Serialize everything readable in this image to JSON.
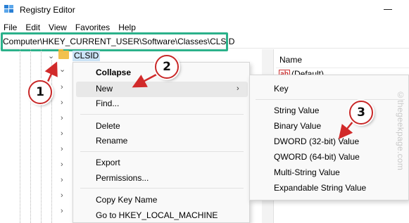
{
  "window": {
    "title": "Registry Editor"
  },
  "menu": {
    "items": [
      "File",
      "Edit",
      "View",
      "Favorites",
      "Help"
    ]
  },
  "address": {
    "path": "Computer\\HKEY_CURRENT_USER\\Software\\Classes\\CLSID"
  },
  "tree": {
    "selected": "CLSID"
  },
  "right_pane": {
    "column_name": "Name",
    "default_value_name": "(Default)",
    "default_icon_text": "ab"
  },
  "context_menu": {
    "collapse": "Collapse",
    "new": "New",
    "find": "Find...",
    "delete": "Delete",
    "rename": "Rename",
    "export": "Export",
    "permissions": "Permissions...",
    "copy_key_name": "Copy Key Name",
    "goto": "Go to HKEY_LOCAL_MACHINE"
  },
  "submenu": {
    "key": "Key",
    "string_value": "String Value",
    "binary_value": "Binary Value",
    "dword_value": "DWORD (32-bit) Value",
    "qword_value": "QWORD (64-bit) Value",
    "multi_string_value": "Multi-String Value",
    "expandable_string_value": "Expandable String Value"
  },
  "steps": {
    "one": "1",
    "two": "2",
    "three": "3"
  },
  "watermark": "©thegeekpage.com",
  "colors": {
    "highlight_box": "#2bb18a",
    "step_border": "#c82828",
    "arrow": "#d12a2a",
    "selection": "#cce4f7"
  }
}
